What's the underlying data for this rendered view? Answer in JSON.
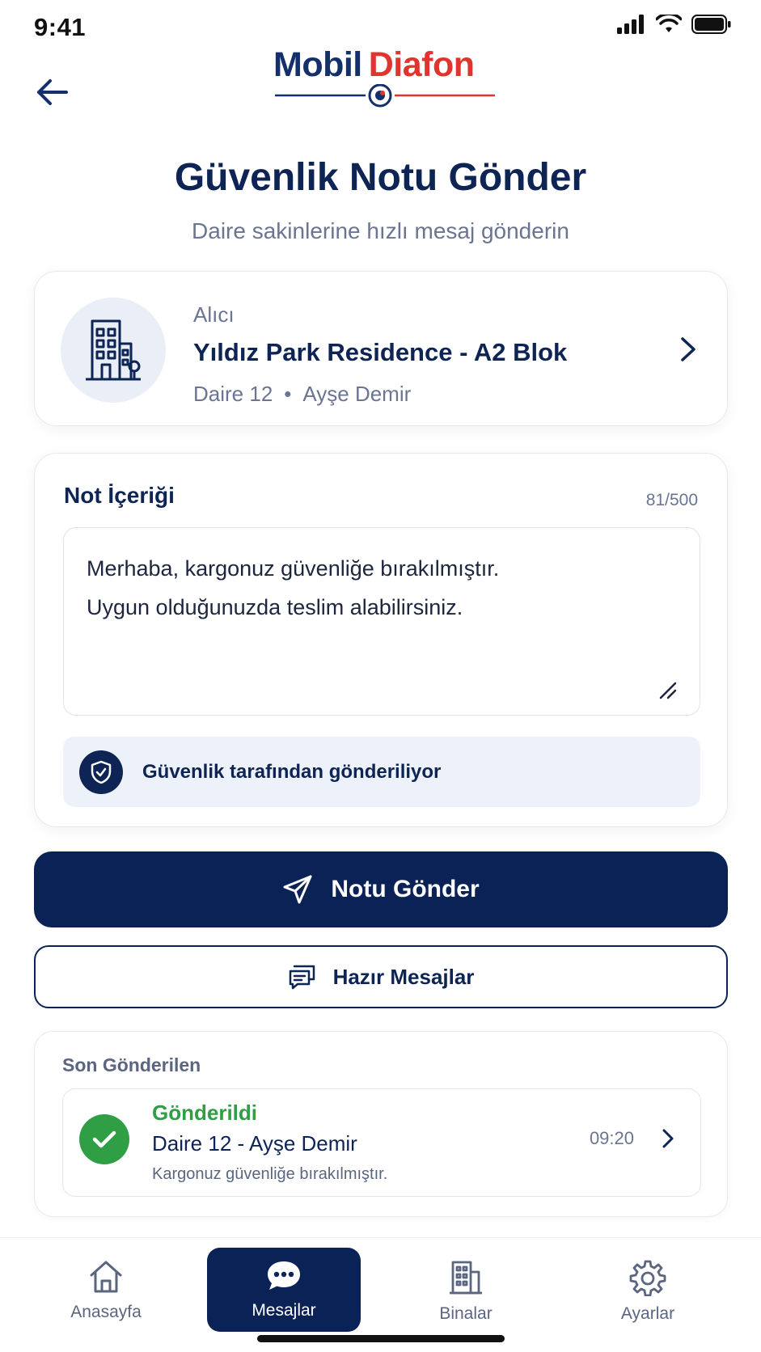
{
  "status_bar": {
    "time": "9:41"
  },
  "header": {
    "logo_part1": "Mobil",
    "logo_part2": "Diafon"
  },
  "page": {
    "title": "Güvenlik Notu Gönder",
    "subtitle": "Daire sakinlerine hızlı mesaj gönderin"
  },
  "recipient": {
    "label": "Alıcı",
    "building": "Yıldız Park Residence - A2 Blok",
    "apartment": "Daire 12",
    "separator": "•",
    "resident": "Ayşe Demir"
  },
  "note": {
    "label": "Not İçeriği",
    "char_count": "81/500",
    "content": "Merhaba, kargonuz güvenliğe bırakılmıştır.\nUygun olduğunuzda teslim alabilirsiniz.",
    "sender_info": "Güvenlik tarafından gönderiliyor"
  },
  "actions": {
    "send_label": "Notu Gönder",
    "templates_label": "Hazır Mesajlar"
  },
  "recent": {
    "title": "Son Gönderilen",
    "status": "Gönderildi",
    "recipient": "Daire 12 - Ayşe Demir",
    "message": "Kargonuz güvenliğe bırakılmıştır.",
    "time": "09:20"
  },
  "nav": {
    "items": [
      {
        "label": "Anasayfa",
        "icon": "home-icon"
      },
      {
        "label": "Mesajlar",
        "icon": "chat-icon",
        "active": true
      },
      {
        "label": "Binalar",
        "icon": "building-icon"
      },
      {
        "label": "Ayarlar",
        "icon": "gear-icon"
      }
    ]
  },
  "colors": {
    "primary": "#0b2257",
    "accent_red": "#e0352f",
    "success": "#2f9e44",
    "muted": "#6b7591"
  }
}
